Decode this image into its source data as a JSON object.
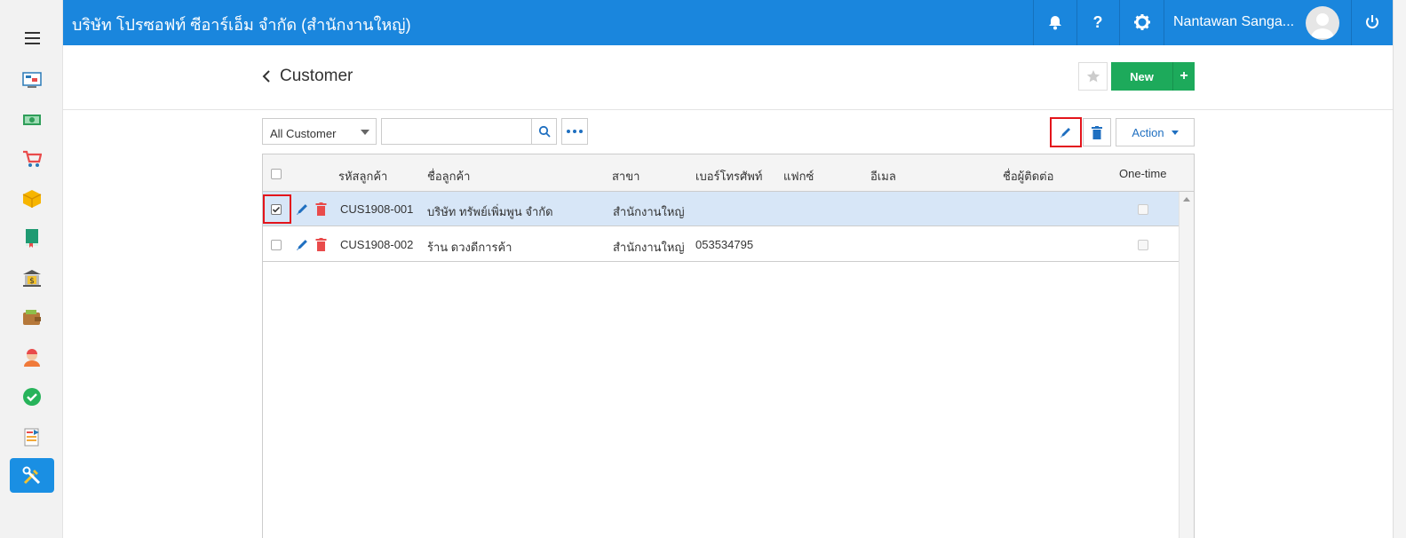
{
  "topbar": {
    "company": "บริษัท โปรซอฟท์ ซีอาร์เอ็ม จำกัด (สำนักงานใหญ่)",
    "user_name": "Nantawan Sanga...",
    "help_label": "?"
  },
  "sidebar": {
    "items": [
      {
        "icon": "dashboard-icon"
      },
      {
        "icon": "money-icon"
      },
      {
        "icon": "cart-icon"
      },
      {
        "icon": "box-icon"
      },
      {
        "icon": "book-icon"
      },
      {
        "icon": "bank-icon"
      },
      {
        "icon": "wallet-icon"
      },
      {
        "icon": "user-icon"
      },
      {
        "icon": "check-icon"
      },
      {
        "icon": "report-icon"
      },
      {
        "icon": "tools-icon",
        "active": true
      }
    ]
  },
  "page": {
    "title": "Customer",
    "new_label": "New",
    "new_plus": "+"
  },
  "filter": {
    "selected": "All Customer",
    "search_value": ""
  },
  "toolbar": {
    "action_label": "Action"
  },
  "table": {
    "columns": [
      "รหัสลูกค้า",
      "ชื่อลูกค้า",
      "สาขา",
      "เบอร์โทรศัพท์",
      "แฟกซ์",
      "อีเมล",
      "ชื่อผู้ติดต่อ",
      "One-time"
    ],
    "rows": [
      {
        "code": "CUS1908-001",
        "name": "บริษัท ทรัพย์เพิ่มพูน จำกัด",
        "branch": "สำนักงานใหญ่",
        "phone": "",
        "fax": "",
        "email": "",
        "contact": "",
        "selected": true
      },
      {
        "code": "CUS1908-002",
        "name": "ร้าน ดวงดีการค้า",
        "branch": "สำนักงานใหญ่",
        "phone": "053534795",
        "fax": "",
        "email": "",
        "contact": "",
        "selected": false
      }
    ]
  },
  "colors": {
    "topbar": "#1a86dd",
    "new_button": "#1daa5b",
    "selected_row": "#d7e6f7",
    "highlight": "#e3141b",
    "edit_icon": "#1f6fc0",
    "delete_icon": "#e94b4b"
  }
}
